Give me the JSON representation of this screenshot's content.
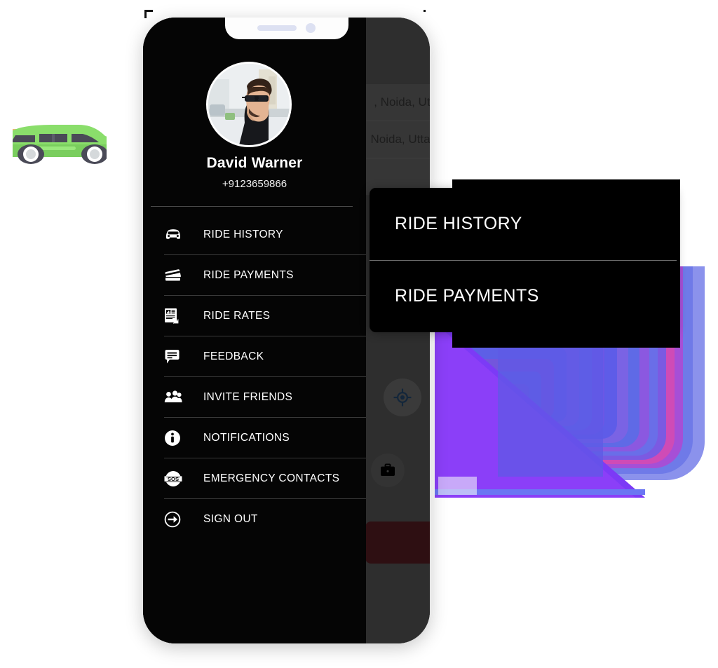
{
  "profile": {
    "name": "David Warner",
    "phone": "+9123659866",
    "avatar_icon": "user-avatar-photo"
  },
  "drawer": {
    "menu": [
      {
        "label": "RIDE HISTORY",
        "icon": "car-icon"
      },
      {
        "label": "RIDE PAYMENTS",
        "icon": "credit-card-icon"
      },
      {
        "label": "RIDE RATES",
        "icon": "document-rates-icon"
      },
      {
        "label": "FEEDBACK",
        "icon": "chat-bubble-icon"
      },
      {
        "label": "INVITE FRIENDS",
        "icon": "people-group-icon"
      },
      {
        "label": "NOTIFICATIONS",
        "icon": "info-circle-icon"
      },
      {
        "label": "EMERGENCY CONTACTS",
        "icon": "sos-circle-icon"
      },
      {
        "label": "SIGN OUT",
        "icon": "sign-out-arrow-icon"
      }
    ]
  },
  "app_background": {
    "rows": [
      ", Noida, Utt.",
      "Noida, Utta.."
    ],
    "locate_icon": "gps-target-icon",
    "briefcase_icon": "briefcase-icon",
    "confirm_button_label": ""
  },
  "callout_cards": {
    "front": [
      "RIDE HISTORY",
      "RIDE PAYMENTS"
    ]
  },
  "decor": {
    "car_icon": "green-car-illustration",
    "swirl_icon": "abstract-purple-swirl"
  },
  "colors": {
    "drawer_bg": "#050505",
    "app_bg": "#2e2e2e",
    "card_bg": "#000000",
    "accent_purple": "#7b3cf5",
    "accent_blue": "#6d78f0",
    "car_green": "#8ade6b",
    "confirm_red": "#2e0f12",
    "notch_dot": "#dde1f2"
  }
}
